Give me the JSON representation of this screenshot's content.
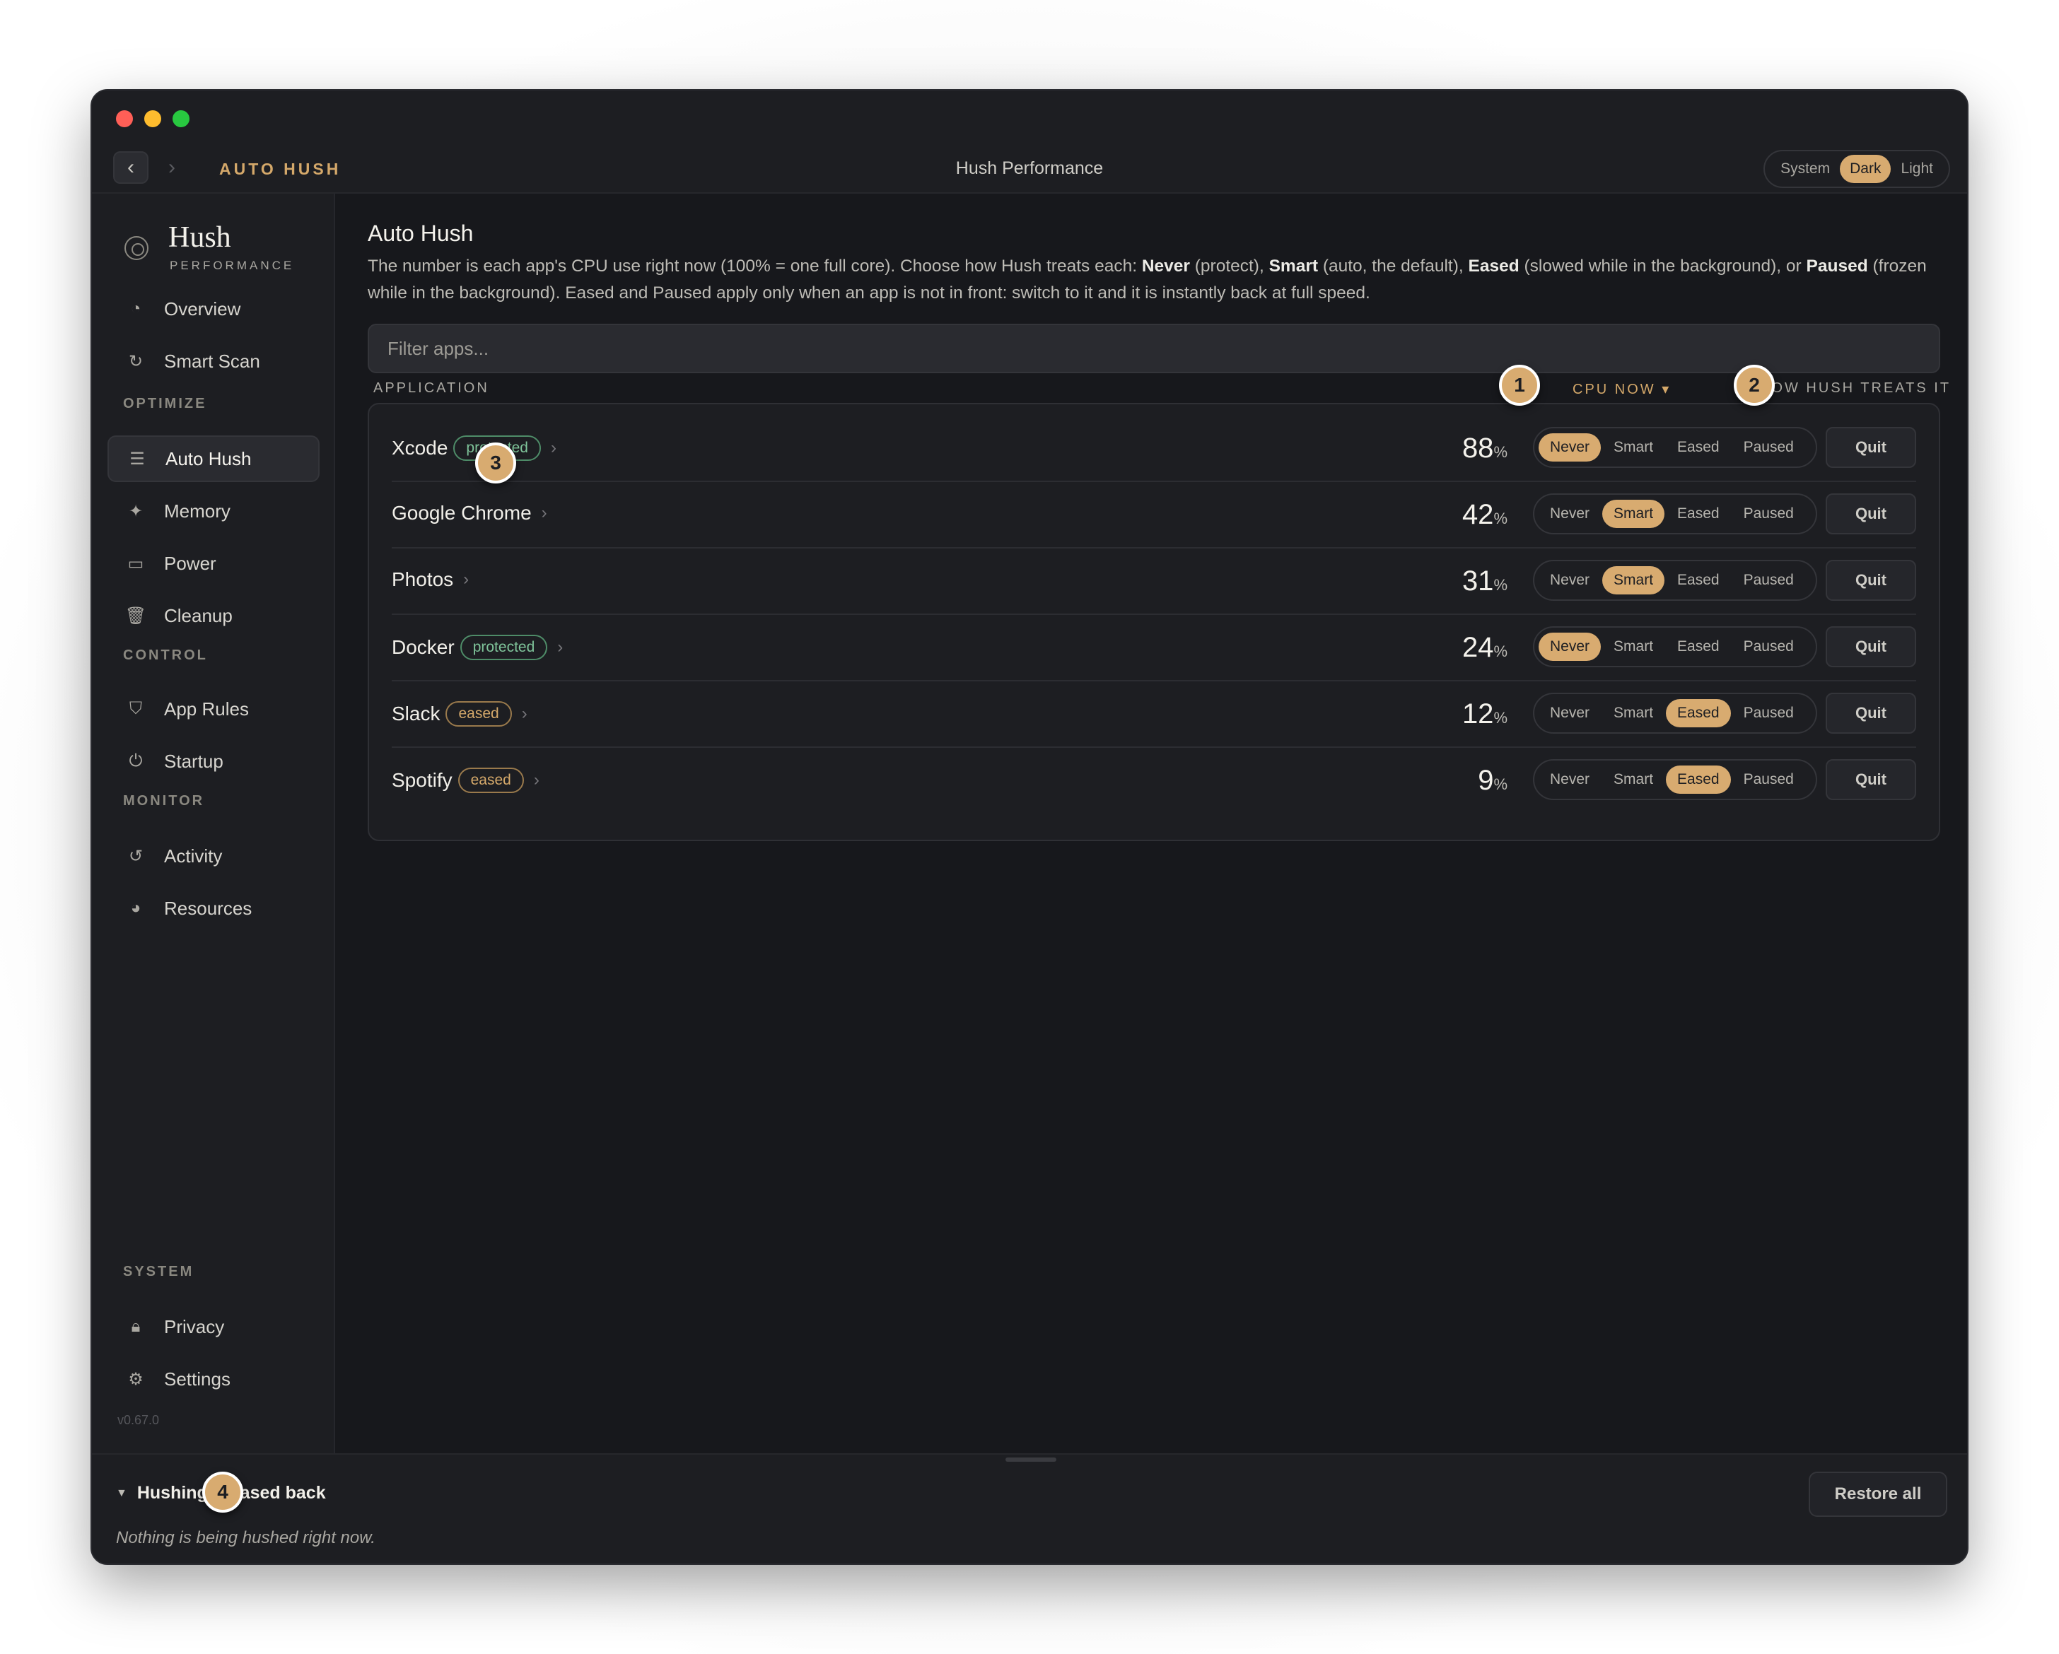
{
  "window": {
    "breadcrumb": "AUTO HUSH",
    "title": "Hush Performance",
    "theme_options": [
      "System",
      "Dark",
      "Light"
    ],
    "theme_selected": "Dark"
  },
  "sidebar": {
    "logo_word": "Hush",
    "logo_sub": "PERFORMANCE",
    "items_top": [
      {
        "label": "Overview",
        "icon": "gauge-icon"
      },
      {
        "label": "Smart Scan",
        "icon": "scan-icon"
      }
    ],
    "section_optimize": "OPTIMIZE",
    "items_optimize": [
      {
        "label": "Auto Hush",
        "icon": "list-icon",
        "active": true
      },
      {
        "label": "Memory",
        "icon": "sparkle-icon"
      },
      {
        "label": "Power",
        "icon": "battery-icon"
      },
      {
        "label": "Cleanup",
        "icon": "trash-icon"
      }
    ],
    "section_control": "CONTROL",
    "items_control": [
      {
        "label": "App Rules",
        "icon": "shield-icon"
      },
      {
        "label": "Startup",
        "icon": "power-icon"
      }
    ],
    "section_monitor": "MONITOR",
    "items_monitor": [
      {
        "label": "Activity",
        "icon": "history-icon"
      },
      {
        "label": "Resources",
        "icon": "pie-icon"
      }
    ],
    "section_system": "SYSTEM",
    "items_system": [
      {
        "label": "Privacy",
        "icon": "lock-icon"
      },
      {
        "label": "Settings",
        "icon": "gear-icon"
      }
    ],
    "version": "v0.67.0"
  },
  "main": {
    "title": "Auto Hush",
    "desc_1": "The number is each app's CPU use right now (100% = one full core). Choose how Hush treats each: ",
    "desc_never": "Never",
    "desc_2": " (protect), ",
    "desc_smart": "Smart",
    "desc_3": " (auto, the default), ",
    "desc_eased": "Eased",
    "desc_4": " (slowed while in the background), or ",
    "desc_paused": "Paused",
    "desc_5": " (frozen while in the background). Eased and Paused apply only when an app is not in front: switch to it and it is instantly back at full speed.",
    "filter_placeholder": "Filter apps...",
    "col_application": "APPLICATION",
    "col_cpu": "CPU NOW ▾",
    "col_how": "HOW HUSH TREATS IT",
    "modes": [
      "Never",
      "Smart",
      "Eased",
      "Paused"
    ],
    "quit_label": "Quit",
    "percent_sign": "%",
    "apps": [
      {
        "name": "Xcode",
        "badge": "protected",
        "cpu": "88",
        "mode": "Never"
      },
      {
        "name": "Google Chrome",
        "badge": "",
        "cpu": "42",
        "mode": "Smart"
      },
      {
        "name": "Photos",
        "badge": "",
        "cpu": "31",
        "mode": "Smart"
      },
      {
        "name": "Docker",
        "badge": "protected",
        "cpu": "24",
        "mode": "Never"
      },
      {
        "name": "Slack",
        "badge": "eased",
        "cpu": "12",
        "mode": "Eased"
      },
      {
        "name": "Spotify",
        "badge": "eased",
        "cpu": "9",
        "mode": "Eased"
      }
    ]
  },
  "bottom": {
    "heading": "Hushing & eased back",
    "empty": "Nothing is being hushed right now.",
    "restore_label": "Restore all"
  },
  "markers": [
    "1",
    "2",
    "3",
    "4"
  ],
  "colors": {
    "accent": "#d8ab70",
    "background": "#17181c",
    "protected": "#7fc49a"
  }
}
